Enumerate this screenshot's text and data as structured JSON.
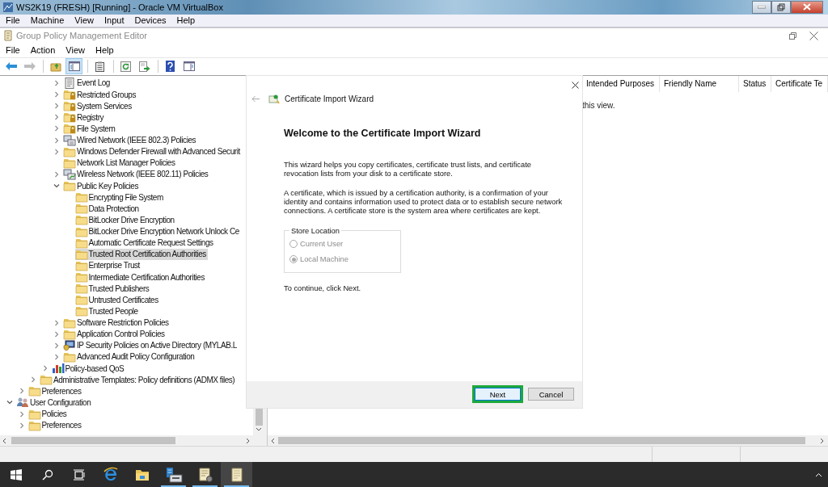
{
  "vm_window": {
    "title": "WS2K19 (FRESH) [Running] - Oracle VM VirtualBox",
    "menu": [
      "File",
      "Machine",
      "View",
      "Input",
      "Devices",
      "Help"
    ]
  },
  "app": {
    "title": "Group Policy Management Editor",
    "menu": [
      "File",
      "Action",
      "View",
      "Help"
    ]
  },
  "toolbar": [
    [
      {
        "kind": "back",
        "disabled": false,
        "pressed": false
      },
      {
        "kind": "forward",
        "disabled": true,
        "pressed": false
      }
    ],
    [
      {
        "kind": "up-folder",
        "disabled": false,
        "pressed": false
      },
      {
        "kind": "console-tree",
        "disabled": false,
        "pressed": true
      }
    ],
    [
      {
        "kind": "properties",
        "disabled": false,
        "pressed": false
      }
    ],
    [
      {
        "kind": "refresh",
        "disabled": false,
        "pressed": false
      },
      {
        "kind": "export",
        "disabled": false,
        "pressed": false
      }
    ],
    [
      {
        "kind": "help",
        "disabled": false,
        "pressed": false
      },
      {
        "kind": "action-pane",
        "disabled": false,
        "pressed": false
      }
    ]
  ],
  "tree_segments": [
    [
      {
        "label": "Event Log",
        "kind": "log",
        "expanded": false,
        "selected": false
      },
      {
        "label": "Restricted Groups",
        "kind": "locked-folder",
        "expanded": false,
        "selected": false
      },
      {
        "label": "System Services",
        "kind": "locked-folder",
        "expanded": false,
        "selected": false
      },
      {
        "label": "Registry",
        "kind": "locked-folder",
        "expanded": false,
        "selected": false
      },
      {
        "label": "File System",
        "kind": "locked-folder",
        "expanded": false,
        "selected": false
      },
      {
        "label": "Wired Network (IEEE 802.3) Policies",
        "kind": "network",
        "expanded": false,
        "selected": false
      },
      {
        "label": "Windows Defender Firewall with Advanced Securit",
        "kind": "folder",
        "expanded": false,
        "selected": false
      },
      {
        "label": "Network List Manager Policies",
        "kind": "folder",
        "selected": false
      },
      {
        "label": "Wireless Network (IEEE 802.11) Policies",
        "kind": "wireless",
        "expanded": false,
        "selected": false
      },
      {
        "label": "Public Key Policies",
        "kind": "folder",
        "expanded": true,
        "selected": false,
        "children": [
          {
            "label": "Encrypting File System",
            "kind": "folder",
            "selected": false
          },
          {
            "label": "Data Protection",
            "kind": "folder",
            "selected": false
          },
          {
            "label": "BitLocker Drive Encryption",
            "kind": "folder",
            "selected": false
          },
          {
            "label": "BitLocker Drive Encryption Network Unlock Ce",
            "kind": "folder",
            "selected": false
          },
          {
            "label": "Automatic Certificate Request Settings",
            "kind": "folder",
            "selected": false
          },
          {
            "label": "Trusted Root Certification Authorities",
            "kind": "folder",
            "selected": true
          },
          {
            "label": "Enterprise Trust",
            "kind": "folder",
            "selected": false
          },
          {
            "label": "Intermediate Certification Authorities",
            "kind": "folder",
            "selected": false
          },
          {
            "label": "Trusted Publishers",
            "kind": "folder",
            "selected": false
          },
          {
            "label": "Untrusted Certificates",
            "kind": "folder",
            "selected": false
          },
          {
            "label": "Trusted People",
            "kind": "folder",
            "selected": false
          }
        ]
      },
      {
        "label": "Software Restriction Policies",
        "kind": "folder",
        "expanded": false,
        "selected": false
      },
      {
        "label": "Application Control Policies",
        "kind": "folder",
        "expanded": false,
        "selected": false
      },
      {
        "label": "IP Security Policies on Active Directory (MYLAB.L",
        "kind": "ip-security",
        "expanded": false,
        "selected": false
      },
      {
        "label": "Advanced Audit Policy Configuration",
        "kind": "folder",
        "expanded": false,
        "selected": false
      }
    ],
    [
      {
        "label": "Policy-based QoS",
        "kind": "chart",
        "expanded": false,
        "selected": false
      }
    ],
    [
      {
        "label": "Administrative Templates: Policy definitions (ADMX files)",
        "kind": "folder",
        "expanded": false,
        "selected": false
      }
    ],
    [
      {
        "label": "Preferences",
        "kind": "folder",
        "expanded": false,
        "selected": false
      }
    ],
    [
      {
        "label": "User Configuration",
        "kind": "users",
        "expanded": true,
        "selected": false,
        "children": [
          {
            "label": "Policies",
            "kind": "folder",
            "expanded": false,
            "selected": false
          },
          {
            "label": "Preferences",
            "kind": "folder",
            "expanded": false,
            "selected": false
          }
        ]
      }
    ]
  ],
  "list_view": {
    "columns": [
      "Intended Purposes",
      "Friendly Name",
      "Status",
      "Certificate Te"
    ],
    "message": "this view."
  },
  "wizard": {
    "title": "Certificate Import Wizard",
    "heading": "Welcome to the Certificate Import Wizard",
    "paragraphs": [
      "This wizard helps you copy certificates, certificate trust lists, and certificate revocation lists from your disk to a certificate store.",
      "A certificate, which is issued by a certification authority, is a confirmation of your identity and contains information used to protect data or to establish secure network connections. A certificate store is the system area where certificates are kept."
    ],
    "store_location": {
      "label": "Store Location",
      "options": [
        {
          "label": "Current User",
          "selected": false,
          "disabled": true
        },
        {
          "label": "Local Machine",
          "selected": true,
          "disabled": true
        }
      ]
    },
    "hint": "To continue, click Next.",
    "buttons": [
      {
        "label": "Next",
        "highlighted": true
      },
      {
        "label": "Cancel",
        "highlighted": false
      }
    ]
  },
  "taskbar": {
    "apps": [
      {
        "kind": "start",
        "running": false,
        "active": false
      },
      {
        "kind": "search",
        "running": false,
        "active": false
      },
      {
        "kind": "task-view",
        "running": false,
        "active": false
      },
      {
        "kind": "browser",
        "running": false,
        "active": false
      },
      {
        "kind": "folder",
        "running": false,
        "active": false
      },
      {
        "kind": "server",
        "running": true,
        "active": false
      },
      {
        "kind": "scroll-gear",
        "running": true,
        "active": false
      },
      {
        "kind": "scroll",
        "running": true,
        "active": true
      }
    ]
  }
}
